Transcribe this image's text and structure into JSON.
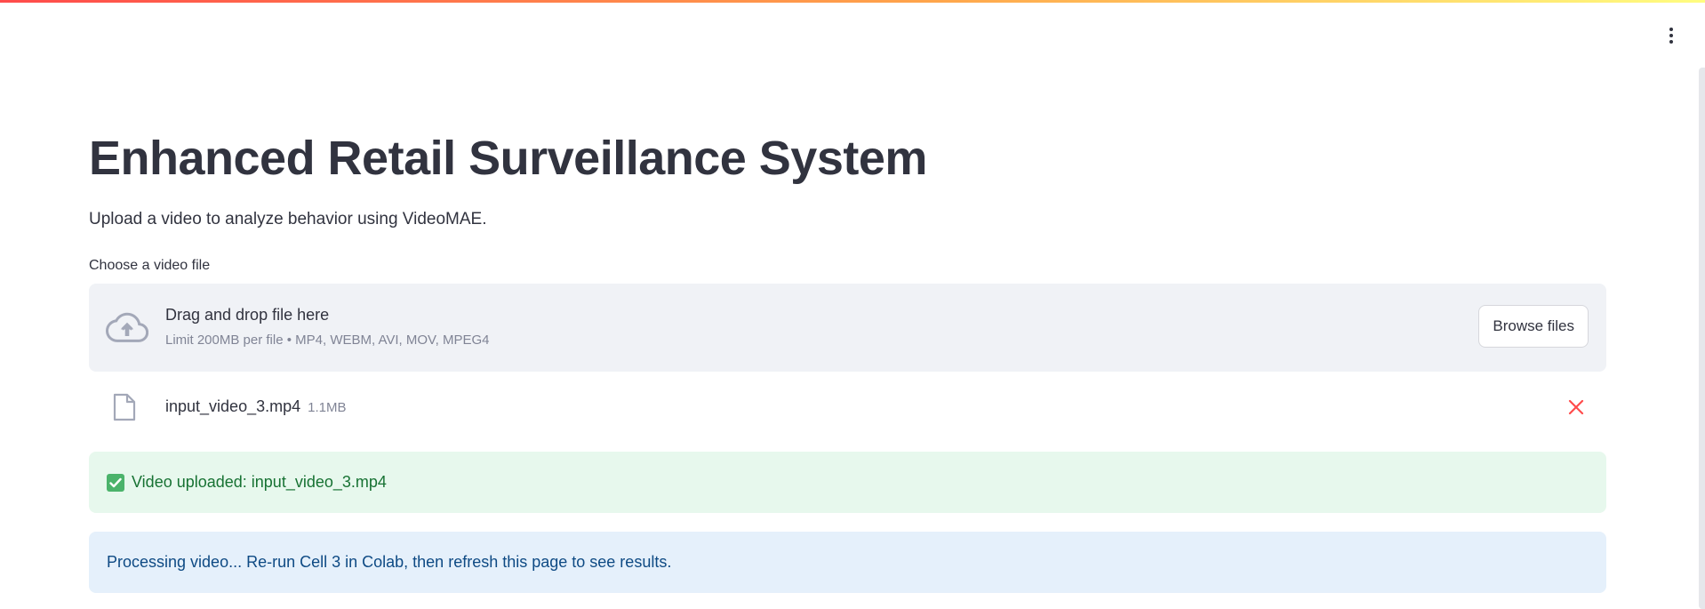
{
  "header": {
    "menu_icon": "more-vertical-icon",
    "decoration_colors": [
      "#ff4b4b",
      "#ffa64b",
      "#fffd80"
    ]
  },
  "main": {
    "title": "Enhanced Retail Surveillance System",
    "subtitle": "Upload a video to analyze behavior using VideoMAE."
  },
  "uploader": {
    "label": "Choose a video file",
    "dropzone_text": "Drag and drop file here",
    "limit_text": "Limit 200MB per file • MP4, WEBM, AVI, MOV, MPEG4",
    "browse_label": "Browse files",
    "icon": "cloud-upload-icon",
    "file": {
      "name": "input_video_3.mp4",
      "size": "1.1MB",
      "icon": "file-icon",
      "remove_icon": "close-icon"
    }
  },
  "alerts": {
    "success": {
      "text": "Video uploaded: input_video_3.mp4",
      "icon": "check-mark-icon",
      "color": "#177233"
    },
    "info": {
      "text": "Processing video... Re-run Cell 3 in Colab, then refresh this page to see results.",
      "color": "#0e4a84"
    }
  }
}
